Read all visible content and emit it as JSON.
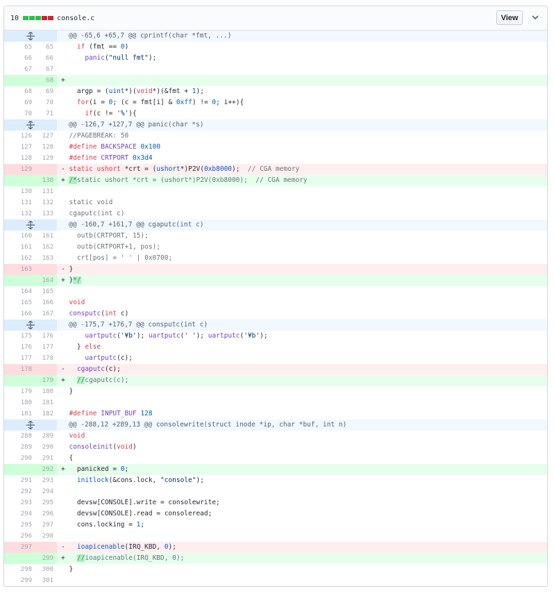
{
  "file": {
    "change_count": "10",
    "filename": "console.c",
    "view_label": "View",
    "diffstat_colors": [
      "#2cbe4e",
      "#2cbe4e",
      "#2cbe4e",
      "#cb2431",
      "#cb2431"
    ]
  },
  "rows": [
    {
      "type": "hunk",
      "text": "@@ -65,6 +65,7 @@ cprintf(char *fmt, ...)"
    },
    {
      "type": "ctx",
      "o": "65",
      "n": "65",
      "html": "    <span class=\"kw\">if</span> (fmt == <span class=\"num\">0</span>)"
    },
    {
      "type": "ctx",
      "o": "66",
      "n": "66",
      "html": "      <span class=\"fn\">panic</span>(<span class=\"str\">\"null fmt\"</span>);"
    },
    {
      "type": "ctx",
      "o": "67",
      "n": "67",
      "html": ""
    },
    {
      "type": "add",
      "o": "",
      "n": "68",
      "html": "+"
    },
    {
      "type": "ctx",
      "o": "68",
      "n": "69",
      "html": "    argp = (<span class=\"num\">uint</span>*)(<span class=\"kw\">void</span>*)(&amp;fmt + <span class=\"num\">1</span>);"
    },
    {
      "type": "ctx",
      "o": "69",
      "n": "70",
      "html": "    <span class=\"kw\">for</span>(i = <span class=\"num\">0</span>; (c = fmt[i] &amp; <span class=\"num\">0xff</span>) != <span class=\"num\">0</span>; i++){"
    },
    {
      "type": "ctx",
      "o": "70",
      "n": "71",
      "html": "      <span class=\"kw\">if</span>(c != <span class=\"str\">'%'</span>){"
    },
    {
      "type": "hunk",
      "text": "@@ -126,7 +127,7 @@ panic(char *s)"
    },
    {
      "type": "ctx",
      "o": "126",
      "n": "127",
      "html": "  <span class=\"cm\">//PAGEBREAK: 50</span>"
    },
    {
      "type": "ctx",
      "o": "127",
      "n": "128",
      "html": "  <span class=\"kw\">#define</span> <span class=\"fn\">BACKSPACE</span> <span class=\"num\">0x100</span>"
    },
    {
      "type": "ctx",
      "o": "128",
      "n": "129",
      "html": "  <span class=\"kw\">#define</span> <span class=\"fn\">CRTPORT</span> <span class=\"num\">0x3d4</span>"
    },
    {
      "type": "del",
      "o": "129",
      "n": "",
      "html": "- <span class=\"kw\">static</span> <span class=\"kw\">ushort</span> *crt = (<span class=\"num\">ushort</span>*)P2V(<span class=\"num\">0xb8000</span>);  <span class=\"cm\">// CGA memory</span>"
    },
    {
      "type": "add",
      "o": "",
      "n": "130",
      "html": "+ <span class=\"addhl cm\">/*</span><span class=\"cm\">static ushort *crt = (ushort*)P2V(0xb8000);  // CGA memory</span>"
    },
    {
      "type": "ctx",
      "o": "130",
      "n": "131",
      "html": ""
    },
    {
      "type": "ctx",
      "o": "131",
      "n": "132",
      "html": "  <span class=\"cm\">static void</span>"
    },
    {
      "type": "ctx",
      "o": "132",
      "n": "133",
      "html": "  <span class=\"cm\">cgaputc(int c)</span>"
    },
    {
      "type": "hunk",
      "text": "@@ -160,7 +161,7 @@ cgaputc(int c)"
    },
    {
      "type": "ctx",
      "o": "160",
      "n": "161",
      "html": "    <span class=\"cm\">outb(CRTPORT, 15);</span>"
    },
    {
      "type": "ctx",
      "o": "161",
      "n": "162",
      "html": "    <span class=\"cm\">outb(CRTPORT+1, pos);</span>"
    },
    {
      "type": "ctx",
      "o": "162",
      "n": "163",
      "html": "    <span class=\"cm\">crt[pos] = ' ' | 0x0700;</span>"
    },
    {
      "type": "del",
      "o": "163",
      "n": "",
      "html": "- }"
    },
    {
      "type": "add",
      "o": "",
      "n": "164",
      "html": "+ }<span class=\"addhl cm\">*/</span>"
    },
    {
      "type": "ctx",
      "o": "164",
      "n": "165",
      "html": ""
    },
    {
      "type": "ctx",
      "o": "165",
      "n": "166",
      "html": "  <span class=\"kw\">void</span>"
    },
    {
      "type": "ctx",
      "o": "166",
      "n": "167",
      "html": "  <span class=\"fn\">consputc</span>(<span class=\"kw\">int</span> c)"
    },
    {
      "type": "hunk",
      "text": "@@ -175,7 +176,7 @@ consputc(int c)"
    },
    {
      "type": "ctx",
      "o": "175",
      "n": "176",
      "html": "      <span class=\"fn\">uartputc</span>(<span class=\"str\">'¥b'</span>); <span class=\"fn\">uartputc</span>(<span class=\"str\">' '</span>); <span class=\"fn\">uartputc</span>(<span class=\"str\">'¥b'</span>);"
    },
    {
      "type": "ctx",
      "o": "176",
      "n": "177",
      "html": "    } <span class=\"kw\">else</span>"
    },
    {
      "type": "ctx",
      "o": "177",
      "n": "178",
      "html": "      <span class=\"fn\">uartputc</span>(c);"
    },
    {
      "type": "del",
      "o": "178",
      "n": "",
      "html": "-   <span class=\"fn\">cgaputc</span>(c);"
    },
    {
      "type": "add",
      "o": "",
      "n": "179",
      "html": "+   <span class=\"addhl cm\">//</span><span class=\"cm\">cgaputc(c);</span>"
    },
    {
      "type": "ctx",
      "o": "179",
      "n": "180",
      "html": "  }"
    },
    {
      "type": "ctx",
      "o": "180",
      "n": "181",
      "html": ""
    },
    {
      "type": "ctx",
      "o": "181",
      "n": "182",
      "html": "  <span class=\"kw\">#define</span> <span class=\"fn\">INPUT_BUF</span> <span class=\"num\">128</span>"
    },
    {
      "type": "hunk",
      "text": "@@ -288,12 +289,13 @@ consolewrite(struct inode *ip, char *buf, int n)"
    },
    {
      "type": "ctx",
      "o": "288",
      "n": "289",
      "html": "  <span class=\"kw\">void</span>"
    },
    {
      "type": "ctx",
      "o": "289",
      "n": "290",
      "html": "  <span class=\"fn\">consoleinit</span>(<span class=\"kw\">void</span>)"
    },
    {
      "type": "ctx",
      "o": "290",
      "n": "291",
      "html": "  {"
    },
    {
      "type": "add",
      "o": "",
      "n": "292",
      "html": "+   panicked = <span class=\"num\">0</span>;"
    },
    {
      "type": "ctx",
      "o": "291",
      "n": "293",
      "html": "    <span class=\"num\">initlock</span>(&amp;cons.lock, <span class=\"str\">\"console\"</span>);"
    },
    {
      "type": "ctx",
      "o": "292",
      "n": "294",
      "html": ""
    },
    {
      "type": "ctx",
      "o": "293",
      "n": "295",
      "html": "    devsw[CONSOLE].write = consolewrite;"
    },
    {
      "type": "ctx",
      "o": "294",
      "n": "296",
      "html": "    devsw[CONSOLE].read = consoleread;"
    },
    {
      "type": "ctx",
      "o": "295",
      "n": "297",
      "html": "    cons.locking = <span class=\"num\">1</span>;"
    },
    {
      "type": "ctx",
      "o": "296",
      "n": "298",
      "html": ""
    },
    {
      "type": "del",
      "o": "297",
      "n": "",
      "html": "-   <span class=\"num\">ioapicenable</span>(IRQ_KBD, <span class=\"num\">0</span>);"
    },
    {
      "type": "add",
      "o": "",
      "n": "299",
      "html": "+   <span class=\"addhl cm\">//</span><span class=\"cm\">ioapicenable(IRQ_KBD, 0);</span>"
    },
    {
      "type": "ctx",
      "o": "298",
      "n": "300",
      "html": "  }"
    },
    {
      "type": "ctx",
      "o": "299",
      "n": "301",
      "html": ""
    }
  ]
}
